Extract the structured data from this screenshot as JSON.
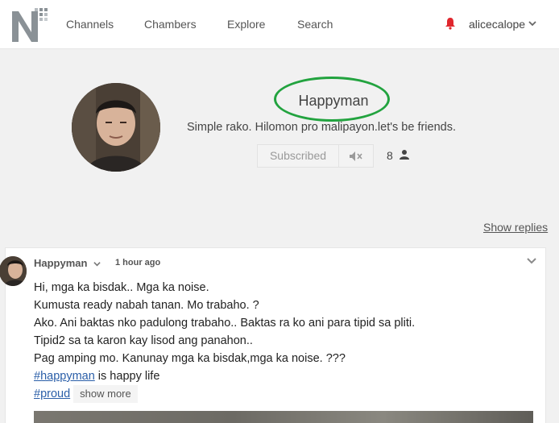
{
  "nav": {
    "channels": "Channels",
    "chambers": "Chambers",
    "explore": "Explore",
    "search": "Search",
    "username": "alicecalope"
  },
  "channel": {
    "name": "Happyman",
    "bio": "Simple rako. Hilomon pro malipayon.let's be friends.",
    "subscribe_label": "Subscribed",
    "subscriber_count": "8"
  },
  "show_replies": "Show replies",
  "post": {
    "author": "Happyman",
    "time": "1 hour ago",
    "lines": [
      "Hi, mga ka bisdak.. Mga ka noise.",
      "Kumusta ready nabah tanan. Mo trabaho. ?",
      "Ako. Ani baktas nko padulong trabaho.. Baktas ra ko ani para tipid sa pliti.",
      "Tipid2 sa ta karon kay lisod ang panahon..",
      "Pag amping mo. Kanunay mga ka bisdak,mga ka noise. ???"
    ],
    "hashtag1": "#happyman",
    "hashtag1_rest": " is happy life",
    "hashtag2": "#proud",
    "show_more": "show more"
  },
  "colors": {
    "highlight_circle": "#22a33f",
    "bell": "#e0262d",
    "link": "#2a5ea8"
  }
}
